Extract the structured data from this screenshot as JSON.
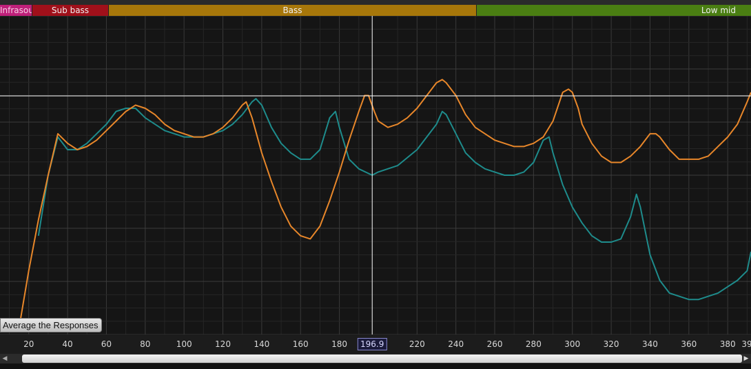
{
  "bands": {
    "infrasonic_label": "Infrasou",
    "sub_bass_label": "Sub bass",
    "bass_label": "Bass",
    "low_mid_label": "Low mid"
  },
  "controls": {
    "average_label": "Average the Responses"
  },
  "cursor": {
    "x_readout": "196.9",
    "x_value": 196.9
  },
  "colors": {
    "orange_trace": "#e8872a",
    "teal_trace": "#1e8c8c",
    "grid": "#3a3a3a",
    "cursor": "#ffffff"
  },
  "chart_data": {
    "type": "line",
    "x_tick_labels": [
      "20",
      "40",
      "60",
      "80",
      "100",
      "120",
      "140",
      "160",
      "180",
      "196.9",
      "220",
      "240",
      "260",
      "280",
      "300",
      "320",
      "340",
      "360",
      "380",
      "39"
    ],
    "x_ticks": [
      20,
      40,
      60,
      80,
      100,
      120,
      140,
      160,
      180,
      220,
      240,
      260,
      280,
      300,
      320,
      340,
      360,
      380
    ],
    "xlim": [
      5.2,
      392
    ],
    "grid": true,
    "series": [
      {
        "color": "orange",
        "x": [
          15,
          20,
          25,
          30,
          35,
          40,
          45,
          50,
          55,
          60,
          65,
          70,
          75,
          80,
          85,
          90,
          95,
          100,
          105,
          110,
          115,
          120,
          125,
          130,
          132,
          135,
          140,
          145,
          150,
          155,
          160,
          165,
          170,
          175,
          180,
          185,
          190,
          193,
          195,
          198,
          200,
          205,
          210,
          215,
          220,
          225,
          230,
          233,
          235,
          240,
          245,
          250,
          255,
          260,
          265,
          270,
          275,
          280,
          285,
          290,
          295,
          298,
          300,
          303,
          305,
          310,
          315,
          320,
          325,
          330,
          335,
          340,
          343,
          345,
          350,
          355,
          360,
          365,
          370,
          375,
          380,
          385,
          390,
          392
        ],
        "y": [
          0.98,
          0.8,
          0.64,
          0.5,
          0.37,
          0.4,
          0.42,
          0.41,
          0.39,
          0.36,
          0.33,
          0.3,
          0.28,
          0.29,
          0.31,
          0.34,
          0.36,
          0.37,
          0.38,
          0.38,
          0.37,
          0.35,
          0.32,
          0.28,
          0.27,
          0.32,
          0.43,
          0.52,
          0.6,
          0.66,
          0.69,
          0.7,
          0.66,
          0.58,
          0.49,
          0.39,
          0.3,
          0.25,
          0.25,
          0.3,
          0.33,
          0.35,
          0.34,
          0.32,
          0.29,
          0.25,
          0.21,
          0.2,
          0.21,
          0.25,
          0.31,
          0.35,
          0.37,
          0.39,
          0.4,
          0.41,
          0.41,
          0.4,
          0.38,
          0.33,
          0.24,
          0.23,
          0.24,
          0.29,
          0.34,
          0.4,
          0.44,
          0.46,
          0.46,
          0.44,
          0.41,
          0.37,
          0.37,
          0.38,
          0.42,
          0.45,
          0.45,
          0.45,
          0.44,
          0.41,
          0.38,
          0.34,
          0.27,
          0.24
        ]
      },
      {
        "color": "teal",
        "x": [
          25,
          30,
          35,
          40,
          45,
          50,
          55,
          60,
          65,
          70,
          75,
          80,
          85,
          90,
          95,
          100,
          105,
          110,
          115,
          120,
          125,
          130,
          135,
          137,
          140,
          145,
          150,
          155,
          160,
          165,
          170,
          175,
          178,
          180,
          185,
          190,
          196.9,
          200,
          210,
          220,
          230,
          233,
          235,
          240,
          245,
          250,
          255,
          260,
          265,
          270,
          275,
          280,
          285,
          288,
          290,
          295,
          300,
          305,
          310,
          315,
          320,
          325,
          330,
          333,
          335,
          340,
          345,
          350,
          355,
          360,
          365,
          370,
          375,
          380,
          385,
          390,
          392
        ],
        "y": [
          0.69,
          0.5,
          0.38,
          0.42,
          0.42,
          0.4,
          0.37,
          0.34,
          0.3,
          0.29,
          0.29,
          0.32,
          0.34,
          0.36,
          0.37,
          0.38,
          0.38,
          0.38,
          0.37,
          0.36,
          0.34,
          0.31,
          0.27,
          0.26,
          0.28,
          0.35,
          0.4,
          0.43,
          0.45,
          0.45,
          0.42,
          0.32,
          0.3,
          0.35,
          0.45,
          0.48,
          0.5,
          0.49,
          0.47,
          0.42,
          0.34,
          0.3,
          0.31,
          0.37,
          0.43,
          0.46,
          0.48,
          0.49,
          0.5,
          0.5,
          0.49,
          0.46,
          0.39,
          0.38,
          0.43,
          0.53,
          0.6,
          0.65,
          0.69,
          0.71,
          0.71,
          0.7,
          0.63,
          0.56,
          0.6,
          0.75,
          0.83,
          0.87,
          0.88,
          0.89,
          0.89,
          0.88,
          0.87,
          0.85,
          0.83,
          0.8,
          0.74
        ]
      }
    ]
  }
}
